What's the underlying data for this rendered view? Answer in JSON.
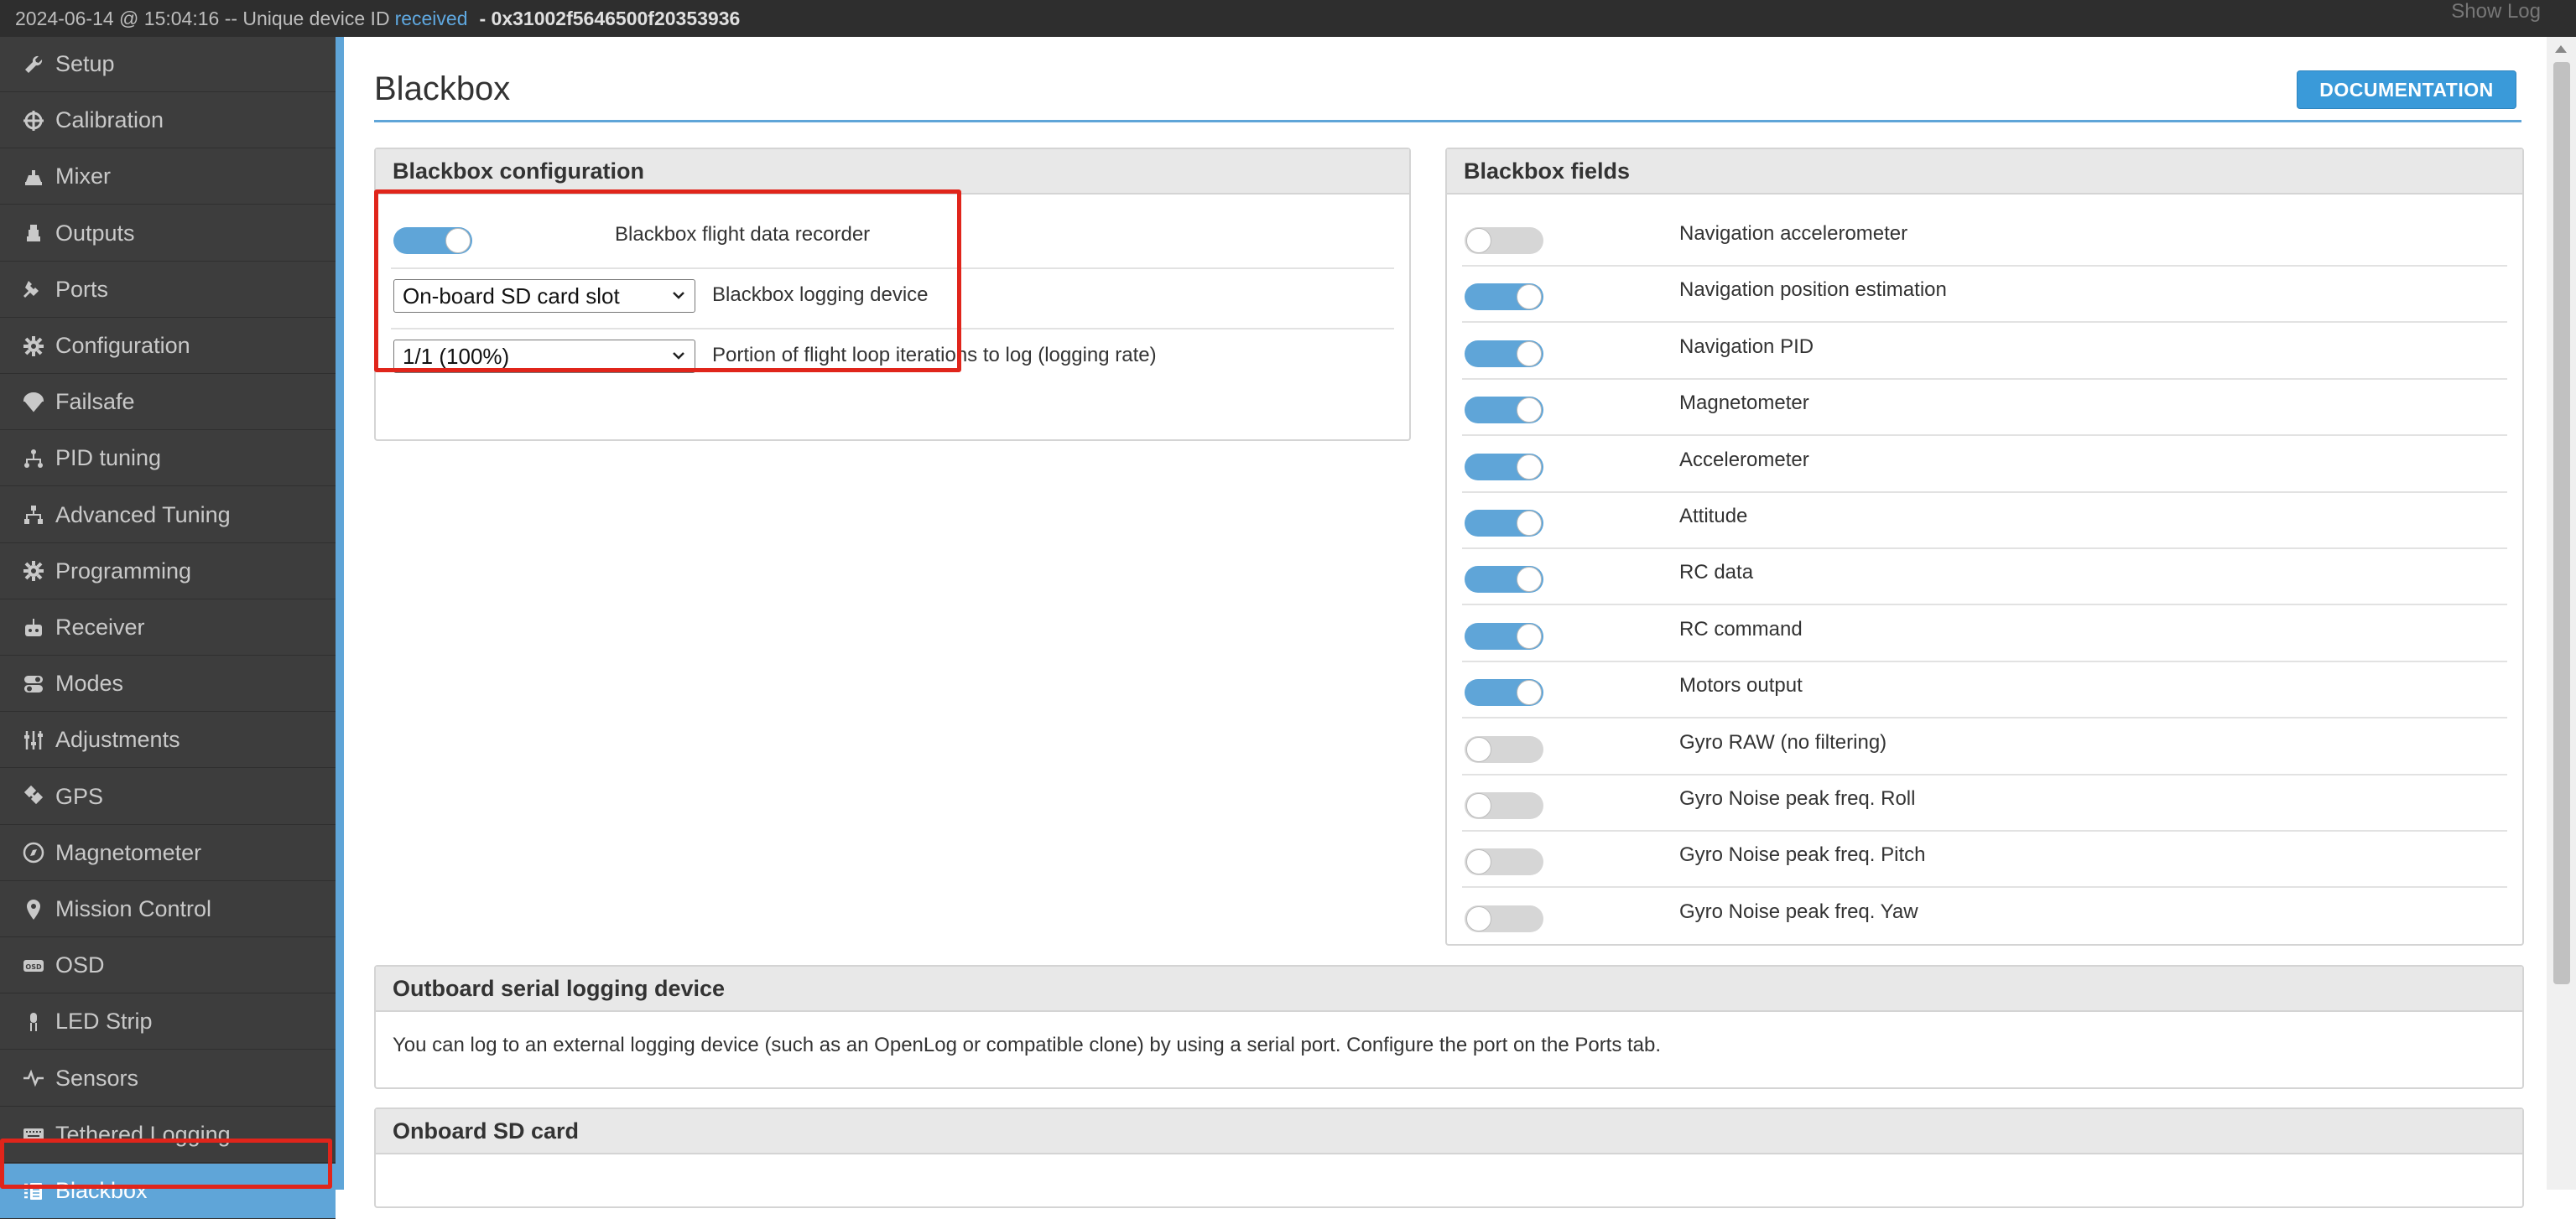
{
  "topbar": {
    "prefix": "2024-06-14 @ 15:04:16 -- Unique device ID",
    "received": "received",
    "device_id": "- 0x31002f5646500f20353936",
    "show_log": "Show Log"
  },
  "sidebar": {
    "items": [
      {
        "label": "Setup",
        "icon": "wrench-icon"
      },
      {
        "label": "Calibration",
        "icon": "crosshair-icon"
      },
      {
        "label": "Mixer",
        "icon": "mixer-icon"
      },
      {
        "label": "Outputs",
        "icon": "outputs-icon"
      },
      {
        "label": "Ports",
        "icon": "plug-icon"
      },
      {
        "label": "Configuration",
        "icon": "gear-icon"
      },
      {
        "label": "Failsafe",
        "icon": "parachute-icon"
      },
      {
        "label": "PID tuning",
        "icon": "pid-icon"
      },
      {
        "label": "Advanced Tuning",
        "icon": "hierarchy-icon"
      },
      {
        "label": "Programming",
        "icon": "gear-icon"
      },
      {
        "label": "Receiver",
        "icon": "receiver-icon"
      },
      {
        "label": "Modes",
        "icon": "toggle-icon"
      },
      {
        "label": "Adjustments",
        "icon": "sliders-icon"
      },
      {
        "label": "GPS",
        "icon": "satellite-icon"
      },
      {
        "label": "Magnetometer",
        "icon": "compass-icon"
      },
      {
        "label": "Mission Control",
        "icon": "map-pin-icon"
      },
      {
        "label": "OSD",
        "icon": "osd-icon"
      },
      {
        "label": "LED Strip",
        "icon": "led-icon"
      },
      {
        "label": "Sensors",
        "icon": "pulse-icon"
      },
      {
        "label": "Tethered Logging",
        "icon": "keyboard-icon"
      },
      {
        "label": "Blackbox",
        "icon": "blackbox-icon",
        "active": true
      }
    ]
  },
  "main": {
    "title": "Blackbox",
    "documentation_label": "DOCUMENTATION"
  },
  "config_panel": {
    "title": "Blackbox configuration",
    "recorder_label": "Blackbox flight data recorder",
    "recorder_enabled": true,
    "device_value": "On-board SD card slot",
    "device_label": "Blackbox logging device",
    "rate_value": "1/1 (100%)",
    "rate_label": "Portion of flight loop iterations to log (logging rate)"
  },
  "fields_panel": {
    "title": "Blackbox fields",
    "fields": [
      {
        "label": "Navigation accelerometer",
        "enabled": false
      },
      {
        "label": "Navigation position estimation",
        "enabled": true
      },
      {
        "label": "Navigation PID",
        "enabled": true
      },
      {
        "label": "Magnetometer",
        "enabled": true
      },
      {
        "label": "Accelerometer",
        "enabled": true
      },
      {
        "label": "Attitude",
        "enabled": true
      },
      {
        "label": "RC data",
        "enabled": true
      },
      {
        "label": "RC command",
        "enabled": true
      },
      {
        "label": "Motors output",
        "enabled": true
      },
      {
        "label": "Gyro RAW (no filtering)",
        "enabled": false
      },
      {
        "label": "Gyro Noise peak freq. Roll",
        "enabled": false
      },
      {
        "label": "Gyro Noise peak freq. Pitch",
        "enabled": false
      },
      {
        "label": "Gyro Noise peak freq. Yaw",
        "enabled": false
      }
    ]
  },
  "outboard_panel": {
    "title": "Outboard serial logging device",
    "text": "You can log to an external logging device (such as an OpenLog or compatible clone) by using a serial port. Configure the port on the Ports tab."
  },
  "sdcard_panel": {
    "title": "Onboard SD card"
  },
  "colors": {
    "accent": "#5fa5d8",
    "highlight": "#e0251b",
    "sidebar_bg": "#3d3d3d",
    "topbar_bg": "#2e2e2e"
  }
}
